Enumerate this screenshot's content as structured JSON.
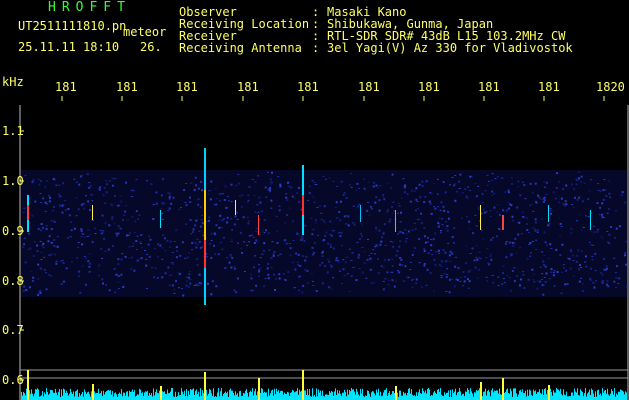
{
  "header": {
    "title": "HROFFT",
    "filename": "UT2511111810.pn",
    "detector": "meteor",
    "datetime": "25.11.11 18:10",
    "count": "26.",
    "info": [
      {
        "label": "Observer",
        "value": "Masaki Kano"
      },
      {
        "label": "Receiving Location",
        "value": "Shibukawa, Gunma, Japan"
      },
      {
        "label": "Receiver",
        "value": "RTL-SDR SDR# 43dB L15 103.2MHz CW"
      },
      {
        "label": "Receiving Antenna",
        "value": "3el Yagi(V) Az 330 for Vladivostok"
      }
    ],
    "separator": ":"
  },
  "axes": {
    "unit": "kHz",
    "x_ticks": [
      "181",
      "181",
      "181",
      "181",
      "181",
      "181",
      "181",
      "181",
      "181",
      "1820"
    ],
    "y_ticks": [
      "1.1",
      "1.0",
      "0.9",
      "0.8",
      "0.7",
      "0.6"
    ]
  },
  "colors": {
    "label_text": "#ffff66",
    "title_text": "#33ff33",
    "background": "#000000",
    "noise": "#1a2a9a",
    "trace": "#00e5ff",
    "peaks": "#ffff33"
  }
}
